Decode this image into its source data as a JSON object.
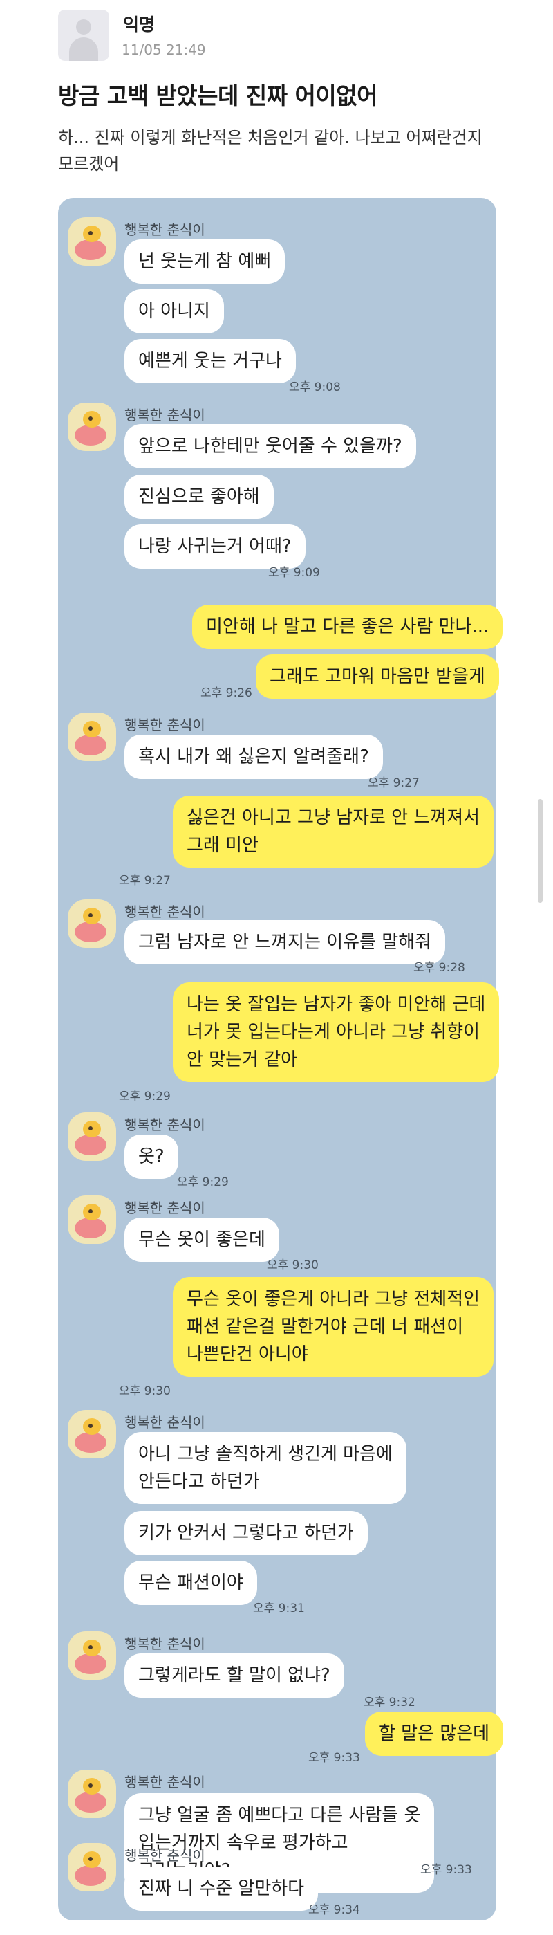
{
  "post": {
    "author": "익명",
    "date": "11/05 21:49",
    "title": "방금 고백 받았는데 진짜 어이없어",
    "body": "하... 진짜 이렇게 화난적은 처음인거 같아. 나보고 어쩌란건지 모르겠어"
  },
  "chat": {
    "sender_name": "행복한 춘식이",
    "messages": [
      {
        "side": "left",
        "text": "넌 웃는게 참 예뻐"
      },
      {
        "side": "left",
        "text": "아 아니지"
      },
      {
        "side": "left",
        "text": "예쁜게 웃는 거구나",
        "time": "오후 9:08"
      },
      {
        "side": "left",
        "text": "앞으로 나한테만 웃어줄 수 있을까?"
      },
      {
        "side": "left",
        "text": "진심으로 좋아해"
      },
      {
        "side": "left",
        "text": "나랑 사귀는거 어때?",
        "time": "오후 9:09"
      },
      {
        "side": "right",
        "text": "미안해 나 말고 다른 좋은 사람 만나..."
      },
      {
        "side": "right",
        "text": "그래도 고마워 마음만 받을게",
        "time": "오후 9:26"
      },
      {
        "side": "left",
        "text": "혹시 내가 왜 싫은지 알려줄래?",
        "time": "오후 9:27"
      },
      {
        "side": "right",
        "lines": [
          "싫은건 아니고 그냥 남자로 안 느껴져서",
          "그래 미안"
        ],
        "time": "오후 9:27"
      },
      {
        "side": "left",
        "text": "그럼 남자로 안 느껴지는 이유를 말해줘",
        "time": "오후 9:28"
      },
      {
        "side": "right",
        "lines": [
          "나는 옷 잘입는 남자가 좋아 미안해 근데",
          "너가 못 입는다는게 아니라 그냥 취향이",
          "안 맞는거 같아"
        ],
        "time": "오후 9:29"
      },
      {
        "side": "left",
        "text": "옷?",
        "time": "오후 9:29"
      },
      {
        "side": "left",
        "text": "무슨 옷이 좋은데",
        "time": "오후 9:30"
      },
      {
        "side": "right",
        "lines": [
          "무슨 옷이 좋은게 아니라 그냥 전체적인",
          "패션 같은걸 말한거야 근데 너 패션이",
          "나쁜단건 아니야"
        ],
        "time": "오후 9:30"
      },
      {
        "side": "left",
        "lines": [
          "아니 그냥 솔직하게 생긴게 마음에",
          "안든다고 하던가"
        ]
      },
      {
        "side": "left",
        "text": "키가 안커서 그렇다고 하던가"
      },
      {
        "side": "left",
        "text": "무슨 패션이야",
        "time": "오후 9:31"
      },
      {
        "side": "left",
        "text": "그렇게라도 할 말이 없냐?",
        "time": "오후 9:32"
      },
      {
        "side": "right",
        "text": "할 말은 많은데",
        "time": "오후 9:33"
      },
      {
        "side": "left",
        "lines": [
          "그냥 얼굴 좀 예쁘다고 다른 사람들 옷",
          "입는거까지 속우로 평가하고",
          "그러는거야?"
        ],
        "time": "오후 9:33"
      },
      {
        "side": "left",
        "text": "진짜 니 수준 알만하다",
        "time": "오후 9:34"
      }
    ]
  },
  "colors": {
    "chat_background": "#b2c7da",
    "my_bubble": "#fff05a",
    "their_bubble": "#ffffff"
  }
}
